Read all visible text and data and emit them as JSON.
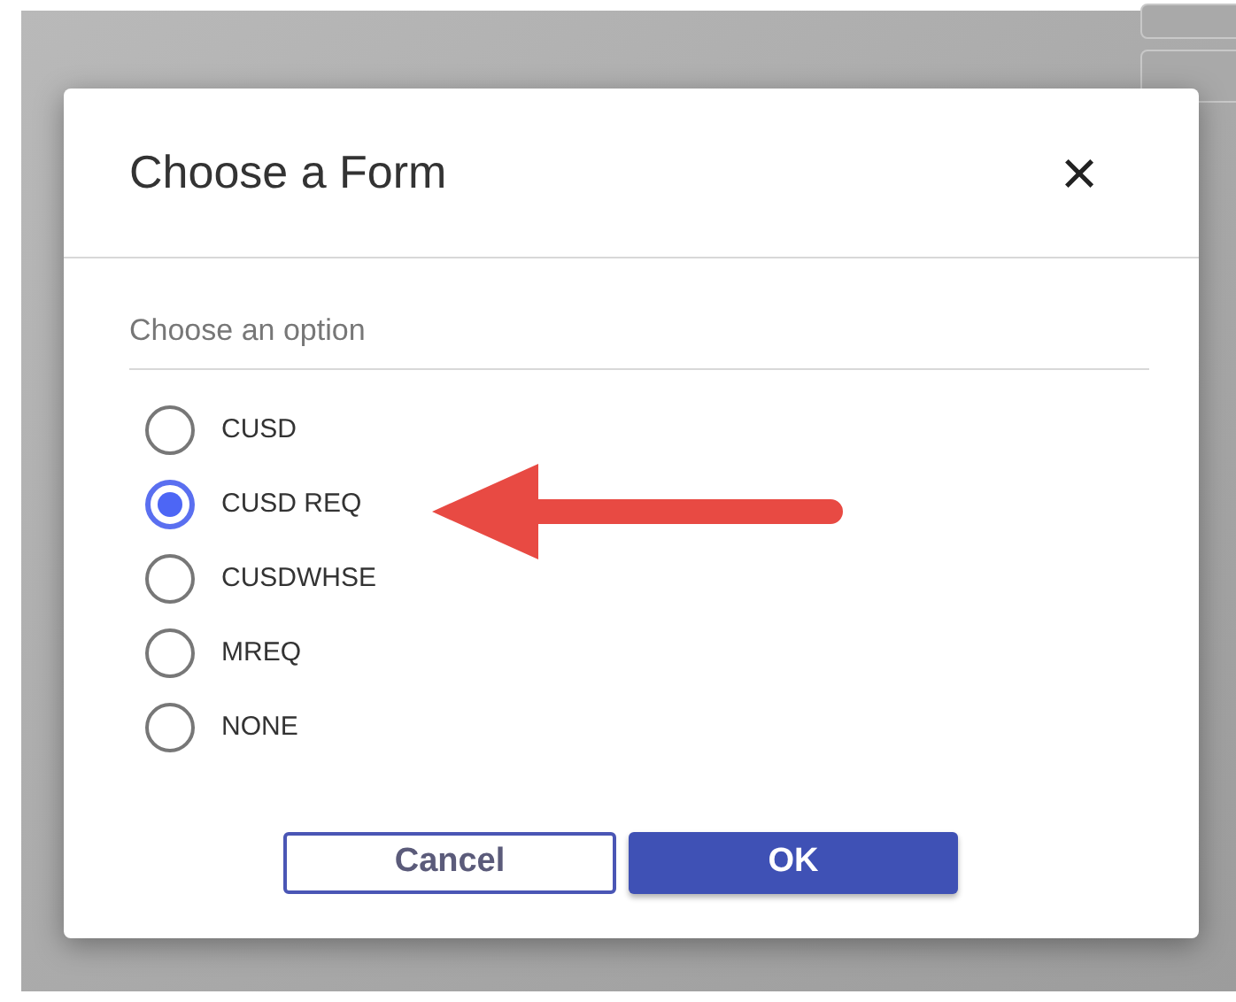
{
  "dialog": {
    "title": "Choose a Form",
    "close": "×",
    "legend": "Choose an option",
    "options": [
      {
        "label": "CUSD",
        "selected": false
      },
      {
        "label": "CUSD REQ",
        "selected": true
      },
      {
        "label": "CUSDWHSE",
        "selected": false
      },
      {
        "label": "MREQ",
        "selected": false
      },
      {
        "label": "NONE",
        "selected": false
      }
    ],
    "buttons": [
      {
        "label": "Cancel",
        "kind": "outline"
      },
      {
        "label": "OK",
        "kind": "primary"
      }
    ]
  }
}
